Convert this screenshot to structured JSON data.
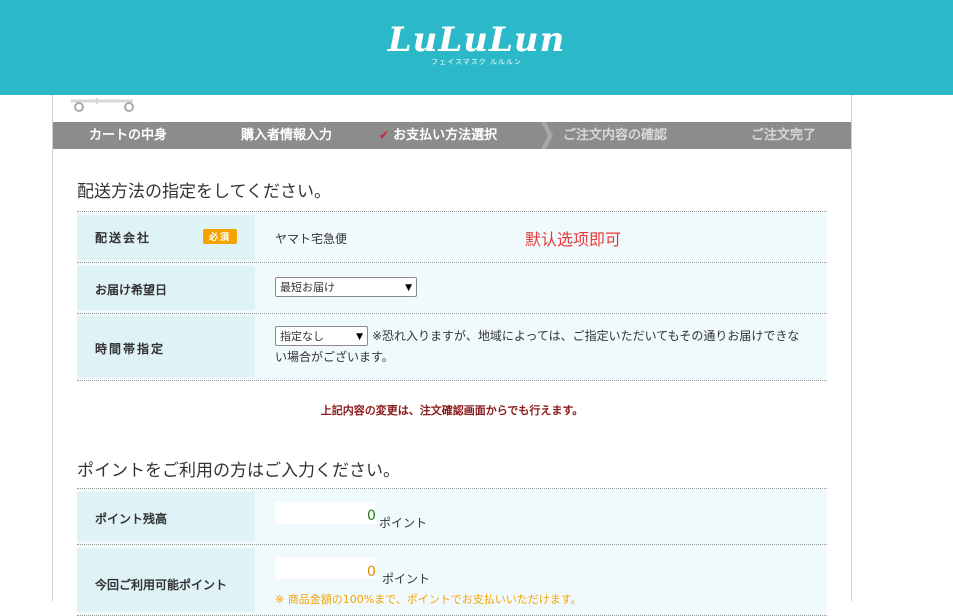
{
  "header": {
    "logo": "LuLuLun",
    "logo_sub": "フェイスマスク ルルルン",
    "bg_color": "#2bb9c9"
  },
  "steps": [
    {
      "label": "カートの中身",
      "state": "done"
    },
    {
      "label": "購入者情報入力",
      "state": "done"
    },
    {
      "label": "お支払い方法選択",
      "state": "current"
    },
    {
      "label": "ご注文内容の確認",
      "state": "upcoming"
    },
    {
      "label": "ご注文完了",
      "state": "upcoming"
    }
  ],
  "delivery": {
    "title": "配送方法の指定をしてください。",
    "company_label": "配送会社",
    "required_badge": "必須",
    "company_value": "ヤマト宅急便",
    "annotation": "默认选项即可",
    "date_label": "お届け希望日",
    "date_value": "最短お届け",
    "time_label": "時間帯指定",
    "time_value": "指定なし",
    "time_note_line1": "※恐れ入りますが、地域によっては、ご指定いただいてもその通りお届けできな",
    "time_note_line2": "い場合がございます。"
  },
  "notice": "上記内容の変更は、注文確認画面からでも行えます。",
  "points": {
    "title": "ポイントをご利用の方はご入力ください。",
    "balance_label": "ポイント残高",
    "balance_value": "0",
    "balance_unit": "ポイント",
    "usable_label": "今回ご利用可能ポイント",
    "usable_value": "0",
    "usable_unit": "ポイント",
    "usable_note": "※ 商品金額の100%まで、ポイントでお支払いいただけます。"
  }
}
